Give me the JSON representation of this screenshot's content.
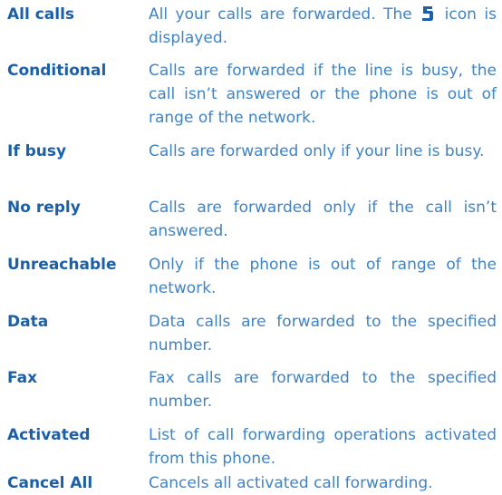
{
  "definitions": [
    {
      "term": "All calls",
      "desc_before_icon": "All your calls are forwarded. The ",
      "icon": "call-forward-icon",
      "desc_after_icon": " icon is displayed."
    },
    {
      "term": "Conditional",
      "desc": "Calls are forwarded if the line is busy, the call isn’t answered or the phone is out of range of the network."
    },
    {
      "term": "If busy",
      "desc": "Calls are forwarded only if your line is busy."
    },
    {
      "term": "No reply",
      "desc": "Calls are forwarded only if the call isn’t answered."
    },
    {
      "term": "Unreachable",
      "desc": "Only if the phone is out of range of the network."
    },
    {
      "term": "Data",
      "desc": "Data calls are forwarded to the specified number."
    },
    {
      "term": "Fax",
      "desc": "Fax calls are forwarded to the specified number."
    },
    {
      "term": "Activated",
      "desc": "List of call forwarding operations activated from this phone."
    },
    {
      "term": "Cancel All",
      "desc": "Cancels all activated call forwarding."
    }
  ],
  "colors": {
    "term": "#1b5fa8",
    "desc": "#3f83c4"
  }
}
